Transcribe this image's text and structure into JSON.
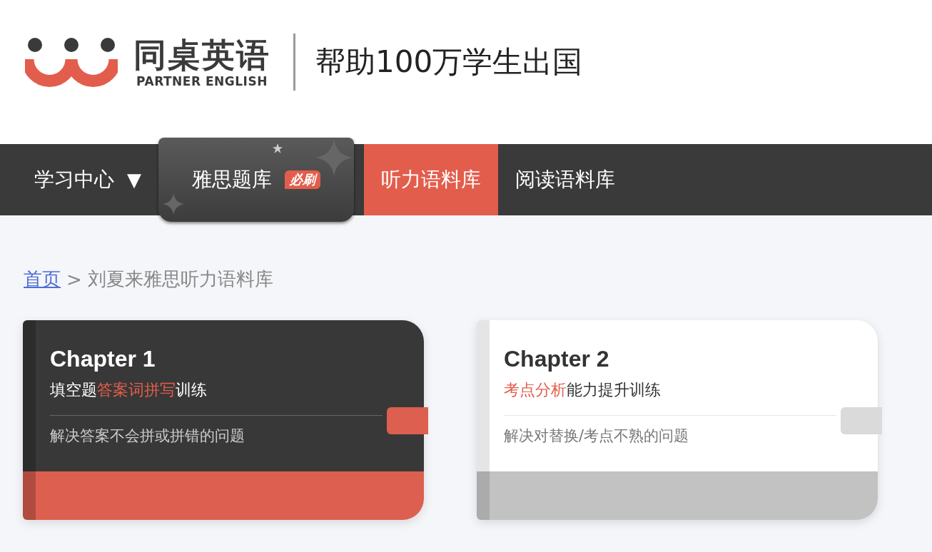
{
  "logo": {
    "name": "同桌英语",
    "subtitle": "PARTNER ENGLISH"
  },
  "tagline": "帮助100万学生出国",
  "nav": [
    {
      "label": "学习中心",
      "caret": "▼",
      "kind": "dropdown",
      "selected": false
    },
    {
      "label": "雅思题库",
      "badge": "必刷",
      "kind": "featured",
      "selected": false
    },
    {
      "label": "听力语料库",
      "kind": "link",
      "selected": true
    },
    {
      "label": "阅读语料库",
      "kind": "link",
      "selected": false
    }
  ],
  "breadcrumb": {
    "home": "首页",
    "separator": ">",
    "current": "刘夏来雅思听力语料库"
  },
  "cards": [
    {
      "title": "Chapter 1",
      "selected": true,
      "subtitle": [
        {
          "text": "填空题",
          "highlight": false
        },
        {
          "text": "答案词拼写",
          "highlight": true
        },
        {
          "text": "训练",
          "highlight": false
        }
      ],
      "description": "解决答案不会拼或拼错的问题"
    },
    {
      "title": "Chapter 2",
      "selected": false,
      "subtitle": [
        {
          "text": "考点分析",
          "highlight": true
        },
        {
          "text": "能力提升训练",
          "highlight": false
        }
      ],
      "description": "解决对替换/考点不熟的问题"
    }
  ]
}
